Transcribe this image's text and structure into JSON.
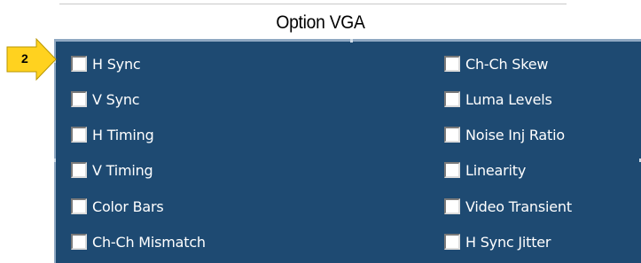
{
  "title": "Option VGA",
  "callout": {
    "number": "2"
  },
  "left_column": [
    {
      "label": "H Sync",
      "checked": false
    },
    {
      "label": "V Sync",
      "checked": false
    },
    {
      "label": "H Timing",
      "checked": false
    },
    {
      "label": "V Timing",
      "checked": false
    },
    {
      "label": "Color Bars",
      "checked": false
    },
    {
      "label": "Ch-Ch Mismatch",
      "checked": false
    }
  ],
  "right_column": [
    {
      "label": "Ch-Ch Skew",
      "checked": false
    },
    {
      "label": "Luma Levels",
      "checked": false
    },
    {
      "label": "Noise Inj Ratio",
      "checked": false
    },
    {
      "label": "Linearity",
      "checked": false
    },
    {
      "label": "Video Transient",
      "checked": false
    },
    {
      "label": "H Sync Jitter",
      "checked": false
    }
  ],
  "colors": {
    "panel": "#1e4a72",
    "callout_fill": "#ffd21f",
    "text": "#ffffff"
  }
}
